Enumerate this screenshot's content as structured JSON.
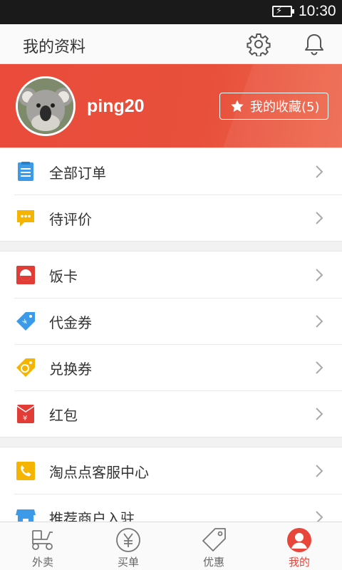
{
  "status_bar": {
    "time": "10:30",
    "battery_icon": "battery-charging-icon"
  },
  "header": {
    "title": "我的资料",
    "settings_icon": "gear-icon",
    "notifications_icon": "bell-icon"
  },
  "profile": {
    "username": "ping20",
    "avatar": "koala-avatar",
    "favorites_label": "我的收藏(5)",
    "favorites_icon": "star-icon",
    "banner_color": "#e94b3c"
  },
  "menu_groups": [
    {
      "items": [
        {
          "label": "全部订单",
          "icon": "order-list-icon",
          "color": "#3d9ae8"
        },
        {
          "label": "待评价",
          "icon": "comment-bubble-icon",
          "color": "#f5b400"
        }
      ]
    },
    {
      "items": [
        {
          "label": "饭卡",
          "icon": "meal-card-icon",
          "color": "#e23c37"
        },
        {
          "label": "代金券",
          "icon": "coupon-tag-icon",
          "color": "#3d9ae8"
        },
        {
          "label": "兑换券",
          "icon": "exchange-tag-icon",
          "color": "#f5b400"
        },
        {
          "label": "红包",
          "icon": "red-envelope-icon",
          "color": "#e23c37"
        }
      ]
    },
    {
      "items": [
        {
          "label": "淘点点客服中心",
          "icon": "phone-icon",
          "color": "#f5b400"
        },
        {
          "label": "推荐商户入驻",
          "icon": "storefront-icon",
          "color": "#3d9ae8"
        }
      ]
    }
  ],
  "tabs": [
    {
      "label": "外卖",
      "icon": "scooter-icon",
      "active": false
    },
    {
      "label": "买单",
      "icon": "yuan-icon",
      "active": false
    },
    {
      "label": "优惠",
      "icon": "tag-icon",
      "active": false
    },
    {
      "label": "我的",
      "icon": "user-icon",
      "active": true
    }
  ],
  "colors": {
    "accent": "#e8463a",
    "text": "#333333",
    "inactive": "#666666"
  }
}
